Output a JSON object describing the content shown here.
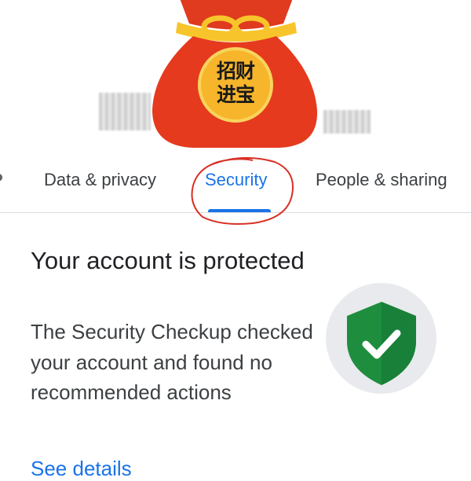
{
  "header": {
    "lucky_bag_text_line1": "招财",
    "lucky_bag_text_line2": "进宝"
  },
  "tabs": [
    {
      "label": "Data & privacy",
      "active": false
    },
    {
      "label": "Security",
      "active": true
    },
    {
      "label": "People & sharing",
      "active": false
    }
  ],
  "status": {
    "headline": "Your account is protected",
    "description": "The Security Checkup checked your account and found no recommended actions",
    "link_label": "See details"
  },
  "colors": {
    "accent": "#1a73e8",
    "shield_green": "#1e8e3e",
    "annotation_red": "#d93025",
    "bag_red": "#e53a1e",
    "ribbon_gold": "#f7c52b"
  },
  "icons": {
    "shield": "shield-check-icon",
    "left_edge_tab_fragment": "tab-fragment"
  }
}
